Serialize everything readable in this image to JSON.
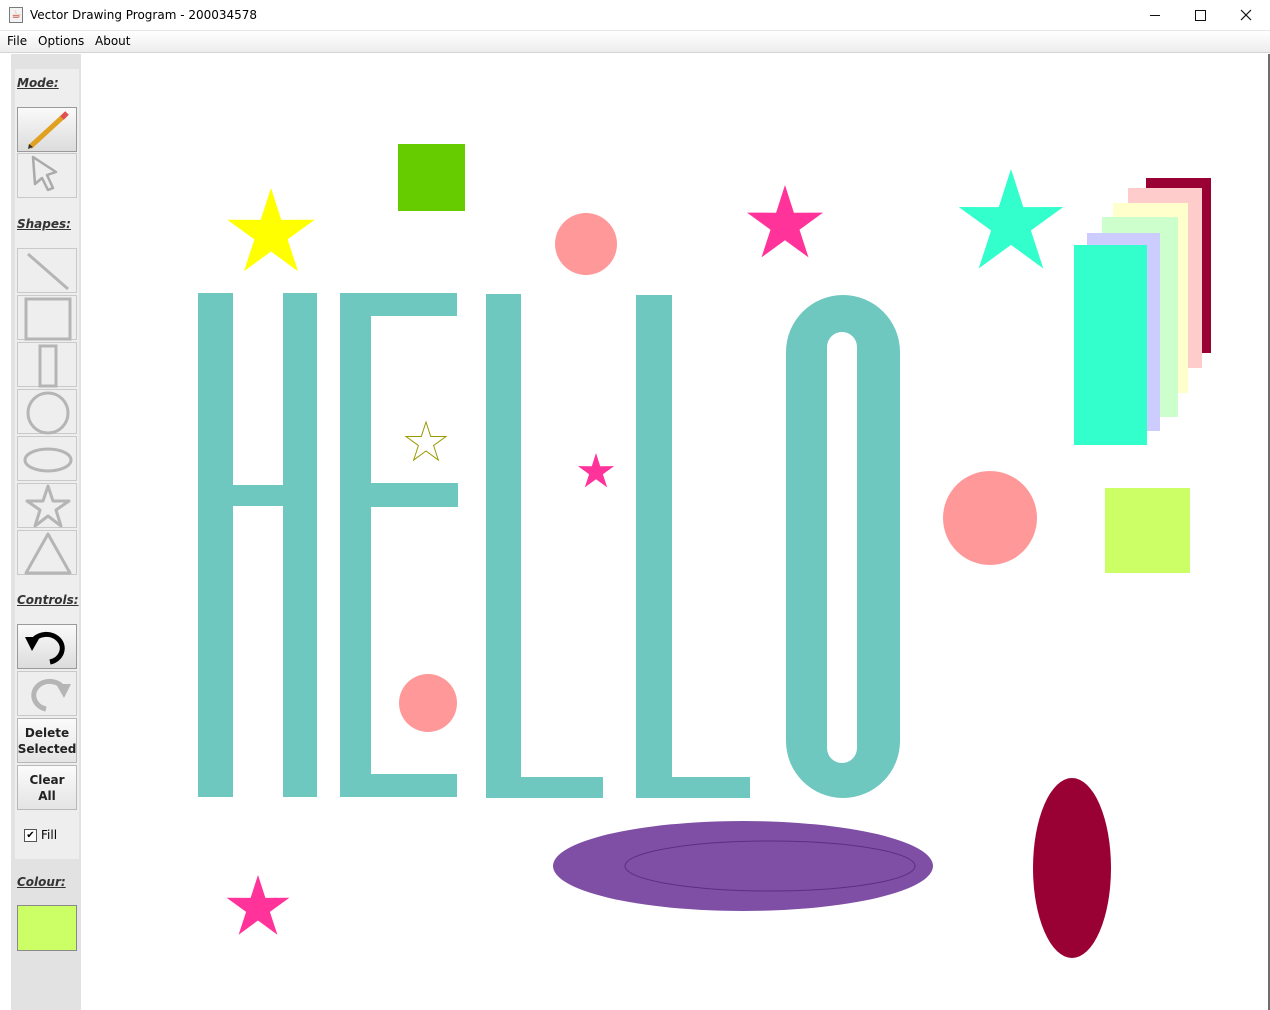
{
  "window": {
    "title": "Vector Drawing Program - 200034578",
    "minimize_glyph": "—",
    "maximize_glyph": "☐",
    "close_glyph": "✕",
    "app_icon": "java-cup-icon"
  },
  "menu": {
    "items": [
      {
        "label": "File"
      },
      {
        "label": "Options"
      },
      {
        "label": "About"
      }
    ]
  },
  "sidebar": {
    "mode_label": "Mode:",
    "mode_tools": [
      {
        "name": "pencil-icon",
        "active": true
      },
      {
        "name": "select-arrow-icon",
        "active": false
      }
    ],
    "shapes_label": "Shapes:",
    "shape_tools": [
      {
        "name": "line-icon"
      },
      {
        "name": "square-icon"
      },
      {
        "name": "rectangle-icon"
      },
      {
        "name": "circle-icon"
      },
      {
        "name": "ellipse-icon"
      },
      {
        "name": "star-icon"
      },
      {
        "name": "triangle-icon"
      }
    ],
    "controls_label": "Controls:",
    "undo_icon": "undo-icon",
    "redo_icon": "redo-icon",
    "delete_selected": {
      "line1": "Delete",
      "line2": "Selected"
    },
    "clear_all": {
      "line1": "Clear",
      "line2": "All"
    },
    "fill_label": "Fill",
    "fill_checked": true,
    "colour_label": "Colour:",
    "colour_value": "#ccff66"
  },
  "canvas": {
    "colors": {
      "teal": "#6fc8c0",
      "yellow": "#ffff00",
      "green": "#66cc00",
      "hot_pink": "#ff3399",
      "salmon": "#ff9999",
      "aqua": "#33ffcc",
      "crimson": "#990033",
      "purple": "#7f4fa6",
      "lime": "#ccff66",
      "olive": "#999900",
      "pale_pink": "#ffcccc",
      "pale_yellow": "#ffffcc",
      "pale_green": "#ccffcc",
      "pale_violet": "#ccccff"
    }
  }
}
